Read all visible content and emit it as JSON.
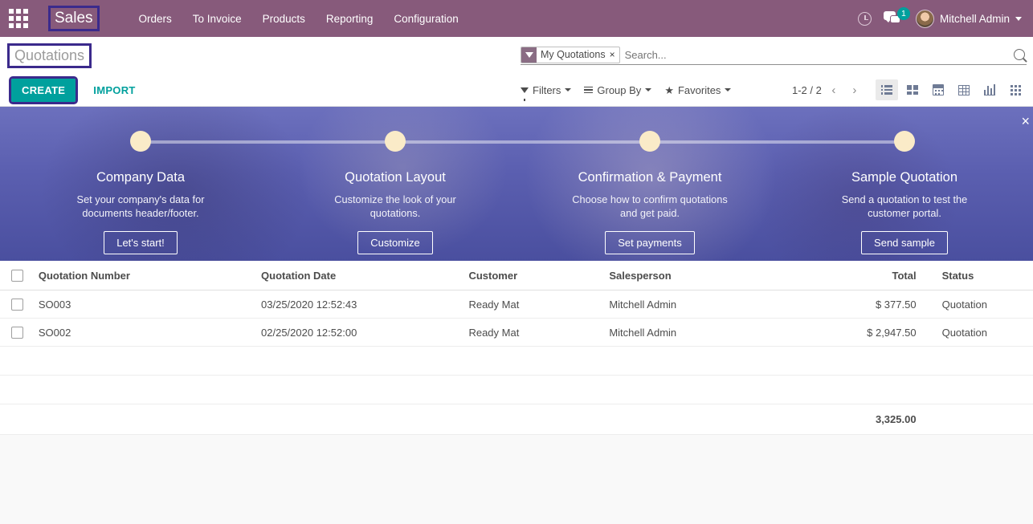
{
  "navbar": {
    "apps_icon": "apps-grid-icon",
    "brand": "Sales",
    "menu": [
      "Orders",
      "To Invoice",
      "Products",
      "Reporting",
      "Configuration"
    ],
    "clock_icon": "clock-icon",
    "chat_icon": "messaging-icon",
    "chat_badge": "1",
    "user_name": "Mitchell Admin",
    "brand_color": "#875A7B",
    "accent_color": "#00A09D",
    "highlight_color": "#3B2A8C"
  },
  "control_panel": {
    "breadcrumb": "Quotations",
    "create_label": "CREATE",
    "import_label": "IMPORT",
    "search": {
      "facet_label": "My Quotations",
      "facet_icon": "filter-funnel-icon",
      "facet_remove_icon": "×",
      "placeholder": "Search...",
      "search_icon": "magnifier-icon"
    },
    "filters_label": "Filters",
    "group_by_label": "Group By",
    "favorites_label": "Favorites",
    "pager": "1-2 / 2",
    "prev_icon": "chevron-left-icon",
    "next_icon": "chevron-right-icon",
    "views": [
      {
        "name": "list-view",
        "icon": "list-icon",
        "active": true
      },
      {
        "name": "kanban-view",
        "icon": "kanban-icon",
        "active": false
      },
      {
        "name": "calendar-view",
        "icon": "calendar-icon",
        "active": false
      },
      {
        "name": "pivot-view",
        "icon": "pivot-table-icon",
        "active": false
      },
      {
        "name": "graph-view",
        "icon": "bar-chart-icon",
        "active": false
      },
      {
        "name": "activity-view",
        "icon": "activity-grid-icon",
        "active": false
      }
    ]
  },
  "banner": {
    "close_icon": "×",
    "steps": [
      {
        "title": "Company Data",
        "desc": "Set your company's data for documents header/footer.",
        "button": "Let's start!"
      },
      {
        "title": "Quotation Layout",
        "desc": "Customize the look of your quotations.",
        "button": "Customize"
      },
      {
        "title": "Confirmation & Payment",
        "desc": "Choose how to confirm quotations and get paid.",
        "button": "Set payments"
      },
      {
        "title": "Sample Quotation",
        "desc": "Send a quotation to test the customer portal.",
        "button": "Send sample"
      }
    ]
  },
  "list": {
    "columns": [
      "Quotation Number",
      "Quotation Date",
      "Customer",
      "Salesperson",
      "Total",
      "Status"
    ],
    "rows": [
      {
        "quotation_number": "SO003",
        "quotation_date": "03/25/2020 12:52:43",
        "customer": "Ready Mat",
        "salesperson": "Mitchell Admin",
        "total": "$ 377.50",
        "status": "Quotation"
      },
      {
        "quotation_number": "SO002",
        "quotation_date": "02/25/2020 12:52:00",
        "customer": "Ready Mat",
        "salesperson": "Mitchell Admin",
        "total": "$ 2,947.50",
        "status": "Quotation"
      }
    ],
    "footer_total": "3,325.00"
  }
}
